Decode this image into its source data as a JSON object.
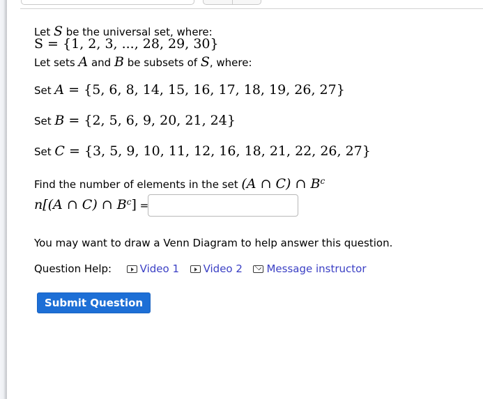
{
  "intro": {
    "line1_prefix": "Let ",
    "line1_var": "S",
    "line1_suffix": " be the universal set, where:",
    "universal_set": "S = {1, 2, 3, ..., 28, 29, 30}",
    "line3_prefix": "Let sets ",
    "line3_var1": "A",
    "line3_mid": " and ",
    "line3_var2": "B",
    "line3_after": " be subsets of ",
    "line3_var3": "S",
    "line3_suffix": ", where:"
  },
  "sets": [
    {
      "label": "Set ",
      "name": "A",
      "eq": " = ",
      "elements": "{5, 6, 8, 14, 15, 16, 17, 18, 19, 26, 27}"
    },
    {
      "label": "Set ",
      "name": "B",
      "eq": " = ",
      "elements": "{2, 5, 6, 9, 20, 21, 24}"
    },
    {
      "label": "Set ",
      "name": "C",
      "eq": " = ",
      "elements": "{3, 5, 9, 10, 11, 12, 16, 18, 21, 22, 26, 27}"
    }
  ],
  "question": {
    "prompt": "Find the number of elements in the set ",
    "set_expr": "(A ∩ C) ∩ B",
    "set_sup": "c",
    "answer_label": "n[(A ∩ C) ∩ B",
    "answer_label_sup": "c",
    "answer_label_close": "]",
    "equals": " =",
    "answer_value": ""
  },
  "hint": "You may want to draw a Venn Diagram to help answer this question.",
  "help": {
    "label": "Question Help:",
    "links": [
      {
        "icon": "play-icon",
        "label": "Video 1"
      },
      {
        "icon": "play-icon",
        "label": "Video 2"
      },
      {
        "icon": "mail-icon",
        "label": "Message instructor"
      }
    ]
  },
  "submit_label": "Submit Question",
  "colors": {
    "link": "#3a3fc4",
    "submit_bg": "#1d6fd6"
  }
}
